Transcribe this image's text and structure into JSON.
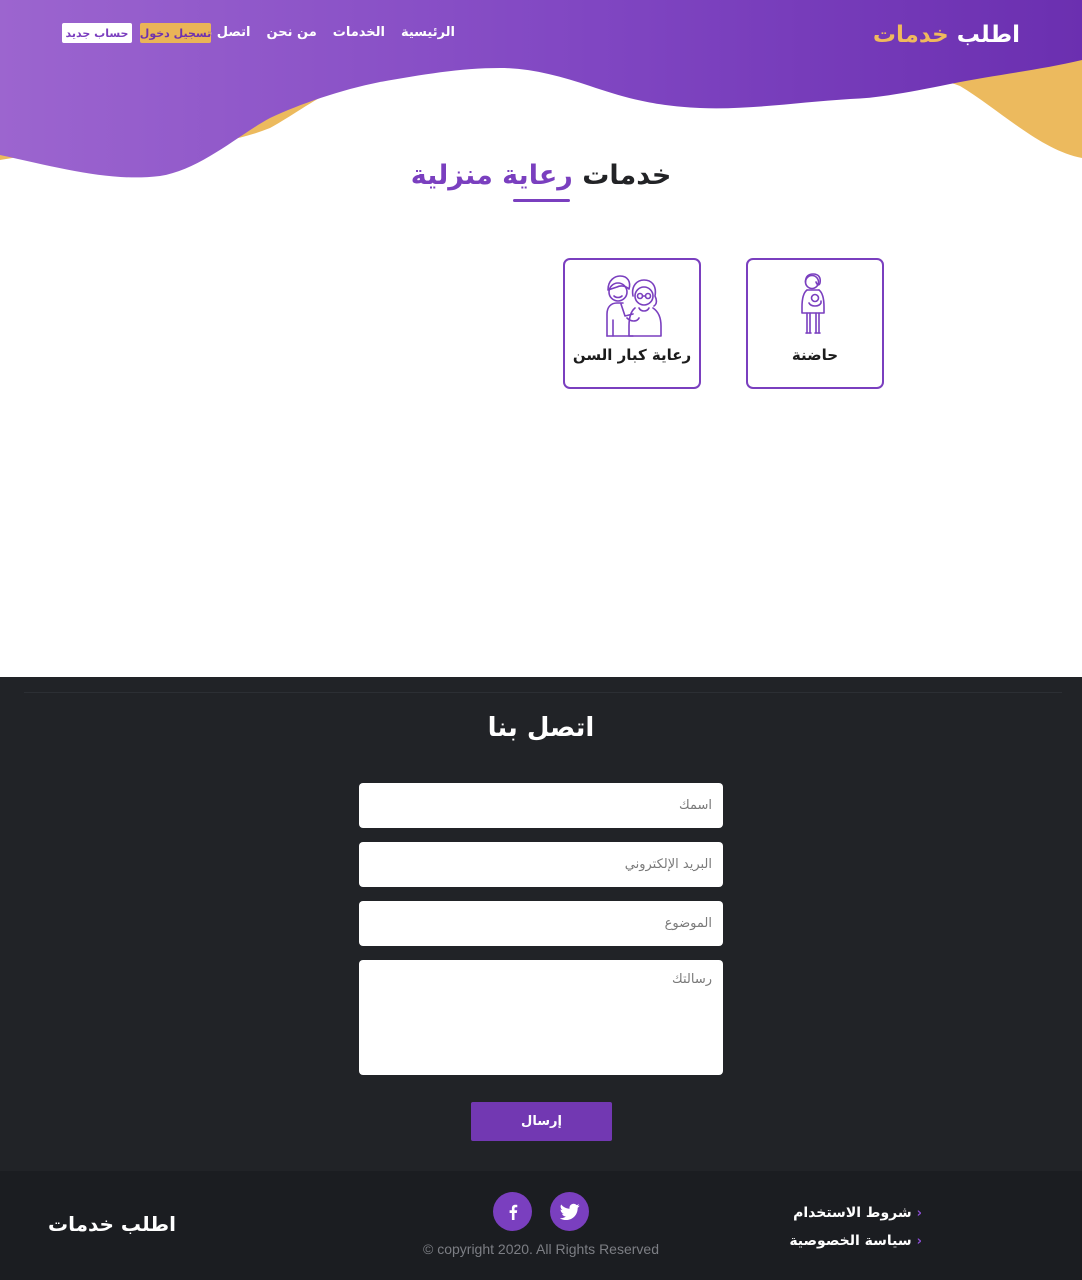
{
  "header": {
    "logo_main": "اطلب",
    "logo_accent": "خدمات",
    "nav": [
      "الرئيسية",
      "الخدمات",
      "من نحن",
      "اتصل بنا"
    ],
    "login_label": "تسجيل دخول",
    "register_label": "حساب جديد"
  },
  "section": {
    "title_part1": "خدمات",
    "title_part2": "رعاية منزلية"
  },
  "services": [
    {
      "label": "حاضنة",
      "icon": "nanny-icon"
    },
    {
      "label": "رعاية كبار السن",
      "icon": "elderly-couple-icon"
    }
  ],
  "contact": {
    "title": "اتصل بنا",
    "name_placeholder": "اسمك",
    "email_placeholder": "البريد الإلكتروني",
    "subject_placeholder": "الموضوع",
    "message_placeholder": "رسالتك",
    "send_label": "إرسال"
  },
  "footer": {
    "logo": "اطلب خدمات",
    "copyright": "© copyright 2020. All Rights Reserved",
    "links": [
      "شروط الاستخدام",
      "سياسة الخصوصية"
    ],
    "social": [
      "facebook-icon",
      "twitter-icon"
    ]
  },
  "colors": {
    "purple": "#7a3fbf",
    "orange": "#eab457",
    "dark": "#212327"
  }
}
